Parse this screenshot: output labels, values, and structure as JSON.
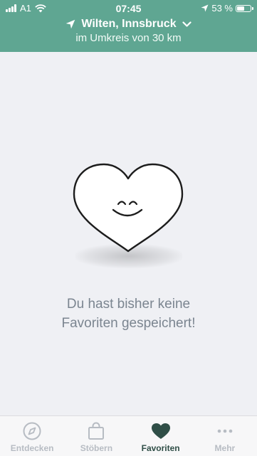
{
  "status_bar": {
    "carrier": "A1",
    "time": "07:45",
    "battery": "53 %",
    "battery_level": 0.53
  },
  "header": {
    "location": "Wilten, Innsbruck",
    "radius": "im Umkreis von 30 km"
  },
  "empty_state": {
    "line1": "Du hast bisher keine",
    "line2": "Favoriten gespeichert!"
  },
  "tabs": [
    {
      "label": "Entdecken",
      "icon": "compass-icon"
    },
    {
      "label": "Stöbern",
      "icon": "shopping-bag-icon"
    },
    {
      "label": "Favoriten",
      "icon": "heart-icon",
      "active": true
    },
    {
      "label": "Mehr",
      "icon": "more-dots-icon"
    }
  ],
  "colors": {
    "header": "#5fa692",
    "background": "#eff0f4",
    "active_tab": "#2f4e47",
    "inactive_tab": "#b7bcc3"
  }
}
